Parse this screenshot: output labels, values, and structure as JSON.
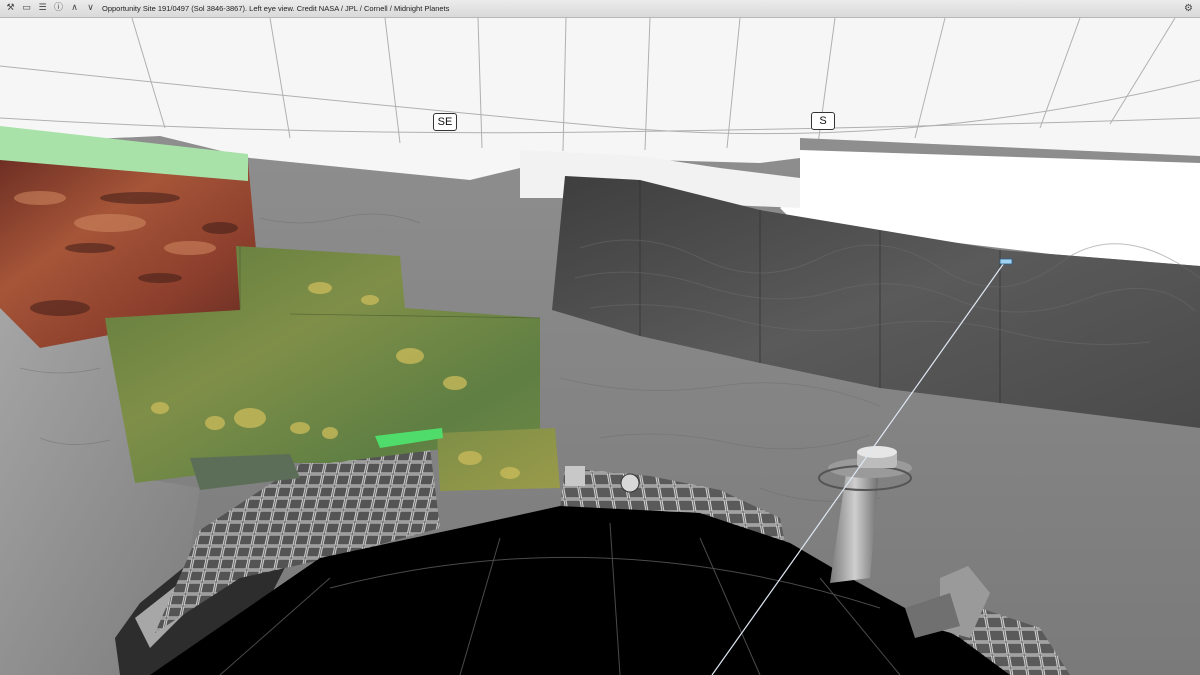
{
  "window": {
    "title": "Opportunity Site 191/0497  (Sol 3846-3867). Left eye view. Credit NASA / JPL / Cornell / Midnight Planets"
  },
  "toolbar": {
    "icons": [
      {
        "name": "tools-icon",
        "glyph": "⚒"
      },
      {
        "name": "image-icon",
        "glyph": "▭"
      },
      {
        "name": "list-icon",
        "glyph": "☰"
      },
      {
        "name": "info-icon",
        "glyph": "ⓘ"
      },
      {
        "name": "chevron-up-icon",
        "glyph": "∧"
      },
      {
        "name": "chevron-down-icon",
        "glyph": "∨"
      }
    ],
    "settings_icon": "⚙"
  },
  "compass": {
    "se_label": "SE",
    "s_label": "S"
  },
  "colors": {
    "sky_grid": "#f6f6f6",
    "terrain_gray": "#8a8a8a",
    "false_color_red": "#9a4a2e",
    "false_color_green": "#6f7f3c",
    "deck": "#000000"
  }
}
